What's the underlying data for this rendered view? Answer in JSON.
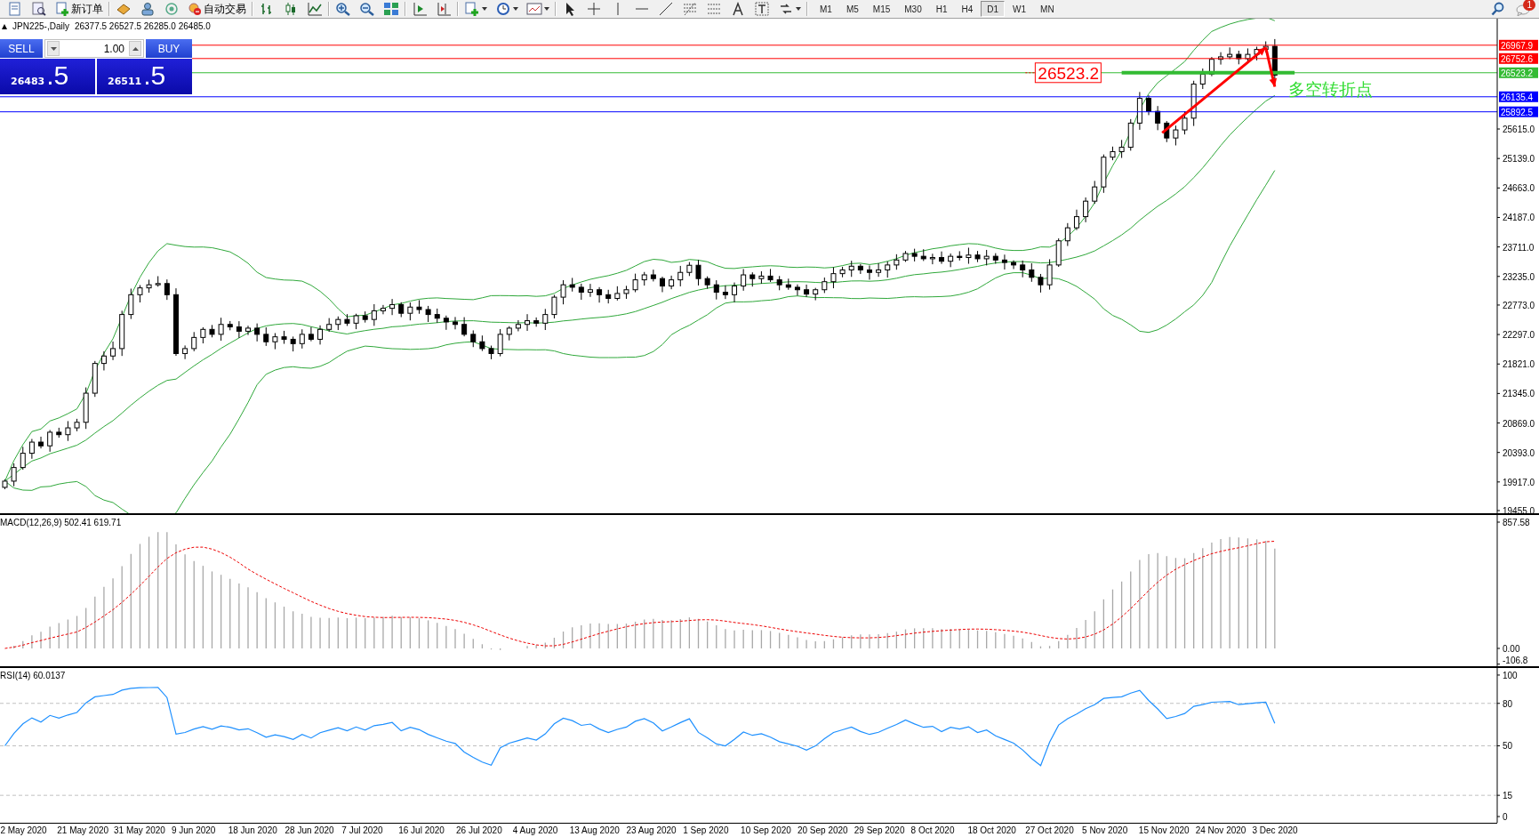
{
  "toolbar": {
    "new_order": "新订单",
    "auto_trading": "自动交易",
    "timeframes": [
      {
        "label": "M1",
        "selected": false
      },
      {
        "label": "M5",
        "selected": false
      },
      {
        "label": "M15",
        "selected": false
      },
      {
        "label": "M30",
        "selected": false
      },
      {
        "label": "H1",
        "selected": false
      },
      {
        "label": "H4",
        "selected": false
      },
      {
        "label": "D1",
        "selected": true
      },
      {
        "label": "W1",
        "selected": false
      },
      {
        "label": "MN",
        "selected": false
      }
    ],
    "notification_count": "1"
  },
  "price_panel": {
    "title": "JPN225-,Daily",
    "ohlc": "26377.5 26527.5 26285.0 26485.0",
    "trade_panel": {
      "sell": "SELL",
      "lot": "1.00",
      "buy": "BUY",
      "bid_main": "26483",
      "bid_tail": ".5",
      "ask_main": "26511",
      "ask_tail": ".5"
    },
    "price_axis": [
      "25615.0",
      "25139.0",
      "24663.0",
      "24187.0",
      "23711.0",
      "23235.0",
      "22773.0",
      "22297.0",
      "21821.0",
      "21345.0",
      "20869.0",
      "20393.0",
      "19917.0",
      "19455.0"
    ],
    "levels": [
      {
        "label": "26967.9",
        "color": "#ff0000"
      },
      {
        "label": "26752.6",
        "color": "#ff0000"
      },
      {
        "label": "26523.2",
        "color": "#33bb33"
      },
      {
        "label": "26135.4",
        "color": "#0000ff"
      },
      {
        "label": "25892.5",
        "color": "#0000ff"
      }
    ],
    "price_box": {
      "label": "26523.2",
      "color": "#ff0000"
    },
    "note": {
      "label": "多空转折点",
      "color": "#33dd33"
    },
    "dates": [
      "2 May 2020",
      "21 May 2020",
      "31 May 2020",
      "9 Jun 2020",
      "18 Jun 2020",
      "28 Jun 2020",
      "7 Jul 2020",
      "16 Jul 2020",
      "26 Jul 2020",
      "4 Aug 2020",
      "13 Aug 2020",
      "23 Aug 2020",
      "1 Sep 2020",
      "10 Sep 2020",
      "20 Sep 2020",
      "29 Sep 2020",
      "8 Oct 2020",
      "18 Oct 2020",
      "27 Oct 2020",
      "5 Nov 2020",
      "15 Nov 2020",
      "24 Nov 2020",
      "3 Dec 2020"
    ]
  },
  "macd_panel": {
    "title": "MACD(12,26,9) 502.41 619.71",
    "axis": [
      "857.58",
      "0.00",
      "-106.8"
    ]
  },
  "rsi_panel": {
    "title": "RSI(14) 60.0137",
    "axis": [
      "100",
      "80",
      "50",
      "15",
      "0"
    ]
  }
}
